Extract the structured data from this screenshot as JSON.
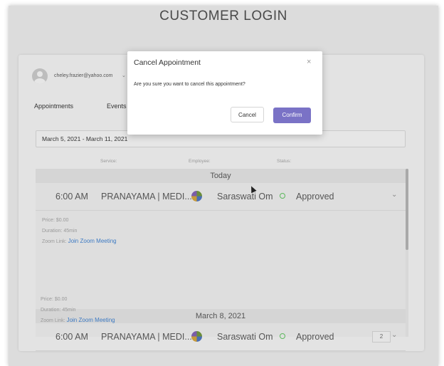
{
  "page": {
    "title": "CUSTOMER LOGIN"
  },
  "user": {
    "email": "cheley.frazier@yahoo.com",
    "menu_icon": "chevron-down-icon"
  },
  "tabs": [
    {
      "label": "Appointments"
    },
    {
      "label": "Events"
    }
  ],
  "filter": {
    "date_range": "March 5, 2021 - March 11, 2021"
  },
  "columns": {
    "service": "Service:",
    "employee": "Employee:",
    "status": "Status:"
  },
  "days": [
    {
      "label": "Today",
      "appointments": [
        {
          "time": "6:00 AM",
          "service": "PRANAYAMA | MEDI...",
          "employee": "Saraswati Om",
          "status": "Approved",
          "status_color": "#5cb85c",
          "count": "",
          "price_label": "Price:",
          "price": "$0.00",
          "duration_label": "Duration:",
          "duration": "45min",
          "zoom_label": "Zoom Link:",
          "zoom_link": "Join Zoom Meeting"
        }
      ]
    },
    {
      "label": "March 8, 2021",
      "appointments": [
        {
          "time": "6:00 AM",
          "service": "PRANAYAMA | MEDI...",
          "employee": "Saraswati Om",
          "status": "Approved",
          "status_color": "#5cb85c",
          "count": "2",
          "price_label": "Price:",
          "price": "$0.00",
          "duration_label": "Duration:",
          "duration": "45min",
          "zoom_label": "Zoom Link:",
          "zoom_link": "Join Zoom Meeting"
        }
      ]
    }
  ],
  "modal": {
    "title": "Cancel Appointment",
    "close_icon": "close-icon",
    "message": "Are you sure you want to cancel this appointment?",
    "cancel_label": "Cancel",
    "confirm_label": "Confirm",
    "confirm_color": "#7a72c6"
  }
}
